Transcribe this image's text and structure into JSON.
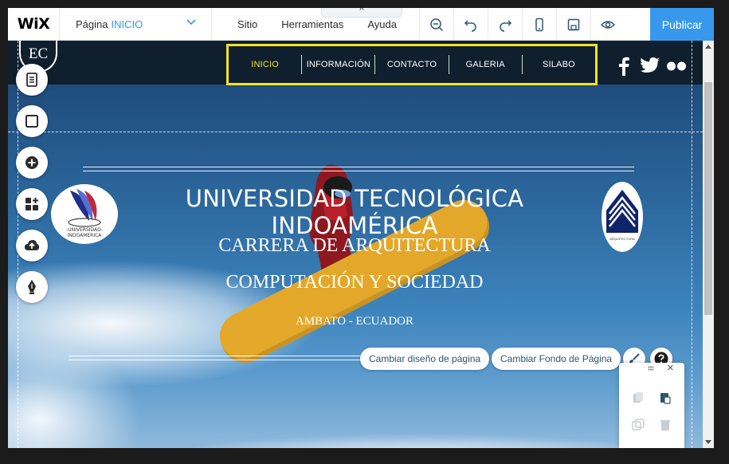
{
  "editor": {
    "logo": "WiX",
    "page_label": "Página",
    "page_current": "INICIO",
    "menu": [
      "Sitio",
      "Herramientas",
      "Ayuda"
    ],
    "collapse_glyph": "^",
    "publish_label": "Publicar",
    "accent_color": "#3899ec"
  },
  "site": {
    "logo_text": "EC",
    "nav": [
      {
        "label": "INICIO",
        "active": true
      },
      {
        "label": "INFORMACIÓN",
        "active": false
      },
      {
        "label": "CONTACTO",
        "active": false
      },
      {
        "label": "GALERIA",
        "active": false
      },
      {
        "label": "SILABO",
        "active": false
      }
    ],
    "nav_highlight_color": "#f2e22a",
    "social_icons": [
      "facebook-icon",
      "twitter-icon",
      "flickr-icon"
    ]
  },
  "hero": {
    "title": "UNIVERSIDAD TECNOLÓGICA INDOAMÉRICA",
    "subtitle_1": "CARRERA DE ARQUITECTURA",
    "subtitle_2": "COMPUTACIÓN Y SOCIEDAD",
    "location": "AMBATO - ECUADOR",
    "logo_left_text": "-UNIVERSIDAD- INDOAMERICA",
    "logo_right_text": "ARQUITECTURA"
  },
  "page_actions": {
    "change_design": "Cambiar diseño de página",
    "change_background": "Cambiar Fondo de Página"
  },
  "panel": {
    "close_glyph": "×"
  }
}
